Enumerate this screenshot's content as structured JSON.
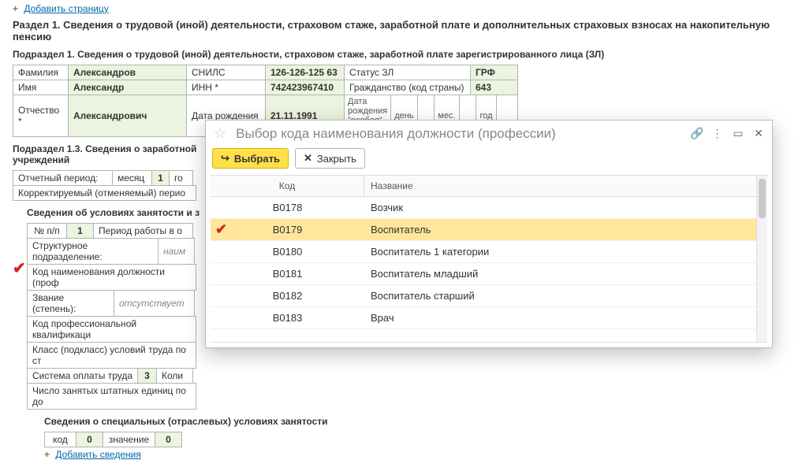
{
  "top_link": {
    "plus": "+",
    "text": "Добавить страницу"
  },
  "section1_title": "Раздел 1. Сведения о трудовой (иной) деятельности, страховом стаже, заработной плате и дополнительных страховых взносах на накопительную пенсию",
  "subsection1_title": "Подраздел 1. Сведения о трудовой (иной) деятельности, страховом стаже, заработной плате зарегистрированного лица (ЗЛ)",
  "person": {
    "fam_lbl": "Фамилия",
    "fam_val": "Александров",
    "snils_lbl": "СНИЛС",
    "snils_val": "126-126-125 63",
    "status_lbl": "Статус ЗЛ",
    "grf_lbl": "ГРФ",
    "name_lbl": "Имя",
    "name_val": "Александр",
    "inn_lbl": "ИНН *",
    "inn_val": "742423967410",
    "citizen_lbl": "Гражданство (код страны)",
    "citizen_val": "643",
    "otch_lbl": "Отчество *",
    "otch_val": "Александрович",
    "dob_lbl": "Дата рождения",
    "dob_val": "21.11.1991",
    "dob_special_lbl": "Дата рождения \"особая\" **:",
    "day_lbl": "день",
    "mon_lbl": "мес.",
    "year_lbl": "год"
  },
  "subsection13_title": "Подраздел 1.3.  Сведения о заработной",
  "subsection13_title2": "учреждений",
  "period_row": {
    "label": "Отчетный период:",
    "mon_lbl": "месяц",
    "mon_val": "1",
    "god_lbl": "го"
  },
  "corr_row": "Корректируемый (отменяемый) перио",
  "employment": {
    "heading": "Сведения об условиях занятости и з",
    "npp_lbl": "№ п/п",
    "npp_val": "1",
    "period_lbl": "Период работы в о",
    "struct_lbl": "Структурное подразделение:",
    "struct_hint": "наим",
    "code_pos_lbl": "Код наименования должности (проф",
    "rank_lbl": "Звание (степень):",
    "rank_hint": "отсутствует",
    "prof_code_lbl": "Код профессиональной квалификаци",
    "class_lbl": "Класс (подкласс) условий труда по ст",
    "pay_lbl": "Система оплаты труда",
    "pay_val": "3",
    "pay_extra": "Коли",
    "units_lbl": "Число занятых штатных единиц по до"
  },
  "special": {
    "heading": "Сведения о специальных (отраслевых) условиях занятости",
    "code_lbl": "код",
    "code_val": "0",
    "val_lbl": "значение",
    "val_val": "0",
    "add_link": "Добавить сведения"
  },
  "dialog": {
    "title": "Выбор кода наименования должности (профессии)",
    "btn_select": "Выбрать",
    "btn_close": "Закрыть",
    "col_code": "Код",
    "col_name": "Название",
    "rows": [
      {
        "code": "В0178",
        "name": "Возчик"
      },
      {
        "code": "В0179",
        "name": "Воспитатель"
      },
      {
        "code": "В0180",
        "name": "Воспитатель 1 категории"
      },
      {
        "code": "В0181",
        "name": "Воспитатель младший"
      },
      {
        "code": "В0182",
        "name": "Воспитатель старший"
      },
      {
        "code": "В0183",
        "name": "Врач"
      }
    ]
  }
}
